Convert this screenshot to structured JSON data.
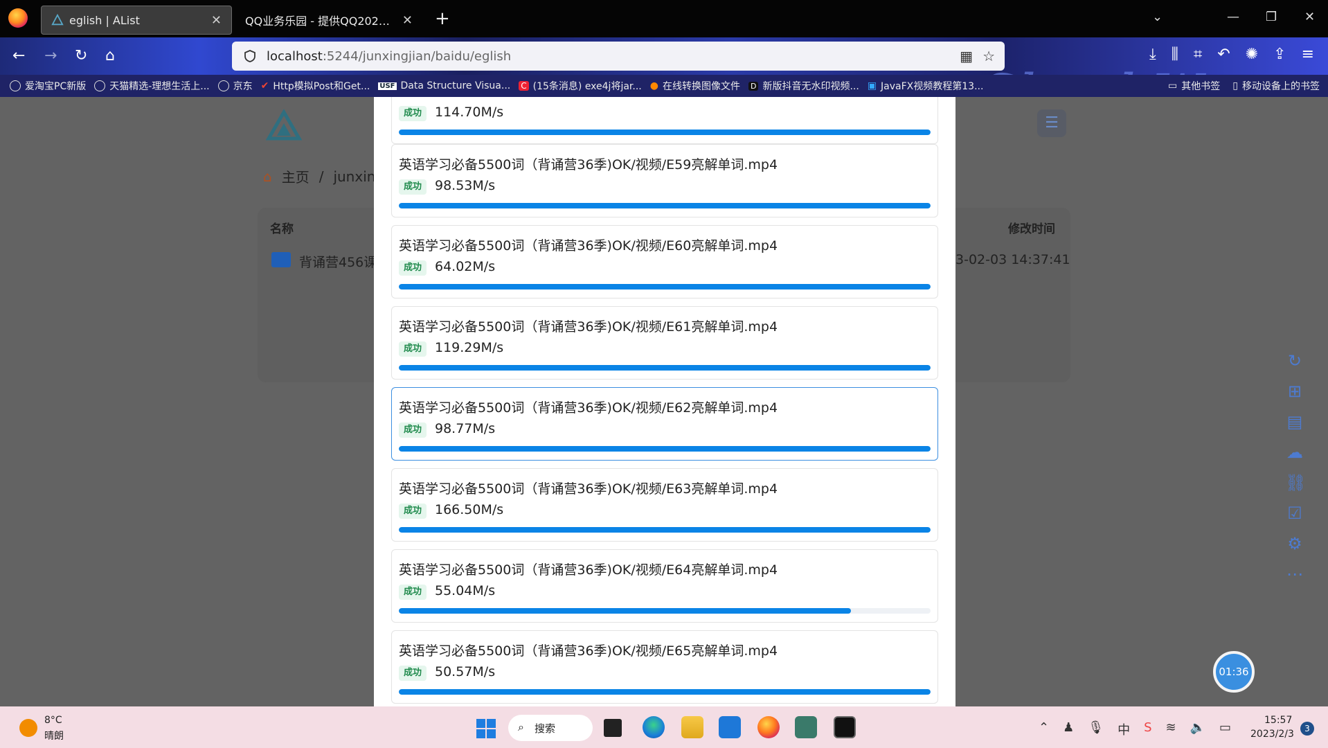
{
  "browser": {
    "tabs": [
      {
        "label": "eglish | AList",
        "active": true
      },
      {
        "label": "QQ业务乐园 - 提供QQ2023最新资",
        "active": false
      }
    ],
    "url_host": "localhost",
    "url_rest": ":5244/junxingjian/baidu/eglish",
    "theme_text": "ShockWave",
    "bookmarks": [
      "爱淘宝PC新版",
      "天猫精选-理想生活上...",
      "京东",
      "Http模拟Post和Get...",
      "Data Structure Visua...",
      "(15条消息) exe4j将jar...",
      "在线转换图像文件",
      "新版抖音无水印视频...",
      "JavaFX视频教程第13..."
    ],
    "bookmarks_right": [
      "其他书签",
      "移动设备上的书签"
    ]
  },
  "alist": {
    "breadcrumb_home": "主页",
    "breadcrumb_sep": "/",
    "breadcrumb_path": "junxing",
    "col_name": "名称",
    "col_time": "修改时间",
    "folder_name": "背诵营456课",
    "folder_time": "3-02-03 14:37:41"
  },
  "tasks": [
    {
      "name": "",
      "status": "成功",
      "speed": "114.70M/s",
      "progress": 1.0
    },
    {
      "name": "英语学习必备5500词（背诵营36季)OK/视频/E59亮解单词.mp4",
      "status": "成功",
      "speed": "98.53M/s",
      "progress": 1.0
    },
    {
      "name": "英语学习必备5500词（背诵营36季)OK/视频/E60亮解单词.mp4",
      "status": "成功",
      "speed": "64.02M/s",
      "progress": 1.0
    },
    {
      "name": "英语学习必备5500词（背诵营36季)OK/视频/E61亮解单词.mp4",
      "status": "成功",
      "speed": "119.29M/s",
      "progress": 1.0
    },
    {
      "name": "英语学习必备5500词（背诵营36季)OK/视频/E62亮解单词.mp4",
      "status": "成功",
      "speed": "98.77M/s",
      "progress": 1.0
    },
    {
      "name": "英语学习必备5500词（背诵营36季)OK/视频/E63亮解单词.mp4",
      "status": "成功",
      "speed": "166.50M/s",
      "progress": 1.0
    },
    {
      "name": "英语学习必备5500词（背诵营36季)OK/视频/E64亮解单词.mp4",
      "status": "成功",
      "speed": "55.04M/s",
      "progress": 0.85
    },
    {
      "name": "英语学习必备5500词（背诵营36季)OK/视频/E65亮解单词.mp4",
      "status": "成功",
      "speed": "50.57M/s",
      "progress": 1.0
    }
  ],
  "timer": "01:36",
  "taskbar": {
    "temperature": "8°C",
    "weather": "晴朗",
    "search_label": "搜索",
    "ime": "中",
    "time": "15:57",
    "date": "2023/2/3",
    "notifications": "3"
  }
}
